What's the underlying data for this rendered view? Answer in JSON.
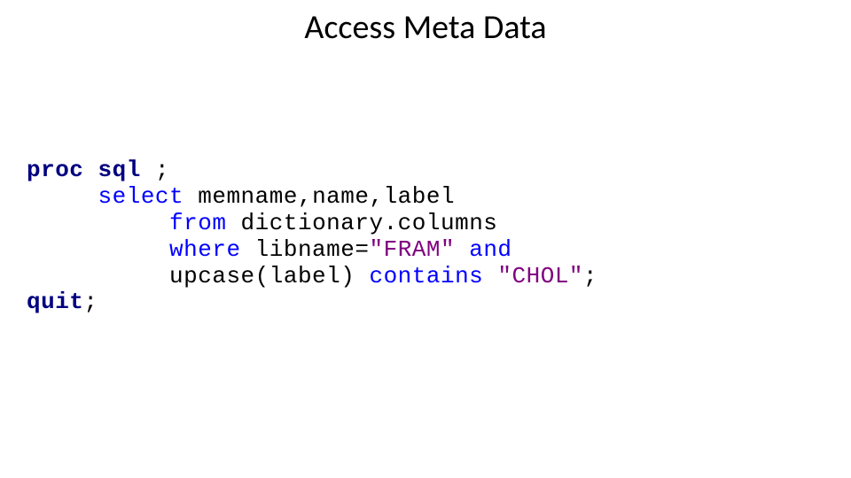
{
  "title": "Access Meta Data",
  "code": {
    "l1_proc": "proc",
    "l1_sql": "sql",
    "l1_pad": " ",
    "l1_semi": ";",
    "l2_pad": "     ",
    "l2_select": "select",
    "l2_cols": " memname,name,label",
    "l3_pad": "          ",
    "l3_from": "from",
    "l3_src": " dictionary.columns",
    "l4_pad": "          ",
    "l4_where": "where",
    "l4_expr1": " libname=",
    "l4_str": "\"FRAM\"",
    "l4_sp": " ",
    "l4_and": "and",
    "l5_pad": "          ",
    "l5_expr2a": "upcase(label) ",
    "l5_contains": "contains",
    "l5_sp": " ",
    "l5_str": "\"CHOL\"",
    "l5_semi": ";",
    "l6_quit": "quit",
    "l6_semi": ";"
  }
}
